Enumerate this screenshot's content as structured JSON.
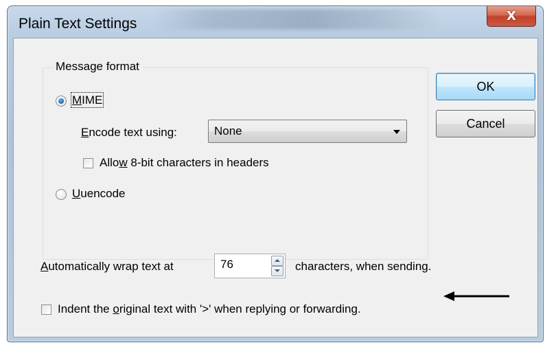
{
  "window": {
    "title": "Plain Text Settings",
    "close_glyph": "X"
  },
  "message_format": {
    "group_label": "Message format",
    "mime": {
      "label_mnemonic": "M",
      "label_rest": "IME",
      "selected": true
    },
    "encode": {
      "label_mnemonic": "E",
      "label_rest": "ncode text using:",
      "value": "None"
    },
    "allow8bit": {
      "label_pre": "Allo",
      "label_mnemonic": "w",
      "label_rest": " 8-bit characters in headers",
      "checked": false
    },
    "uuencode": {
      "label_mnemonic": "U",
      "label_rest": "uencode",
      "selected": false
    }
  },
  "buttons": {
    "ok": "OK",
    "cancel": "Cancel"
  },
  "wrap": {
    "label_mnemonic": "A",
    "label_rest": "utomatically wrap text at",
    "value": "76",
    "suffix": "characters, when sending."
  },
  "indent": {
    "label_pre": "Indent the ",
    "label_mnemonic": "o",
    "label_rest": "riginal text with '>' when replying or forwarding.",
    "checked": false
  },
  "colors": {
    "titlebar": "#b7cbe0",
    "close_button": "#c1422b",
    "dialog_bg": "#f0f0f0",
    "default_button": "#bee6fd"
  },
  "icons": {
    "close": "close-icon",
    "dropdown": "chevron-down-icon",
    "spin_up": "spin-up-icon",
    "spin_down": "spin-down-icon",
    "annotation": "arrow-left-icon"
  }
}
